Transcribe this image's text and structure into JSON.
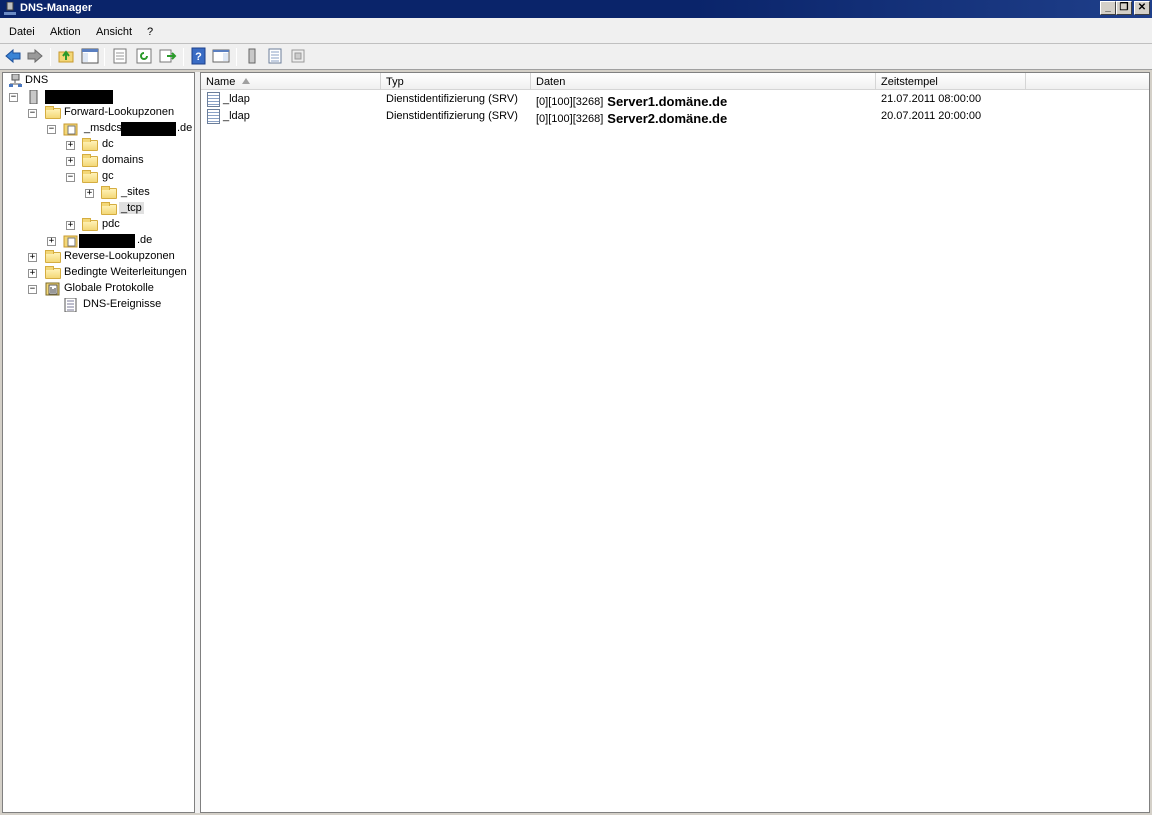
{
  "window": {
    "title": "DNS-Manager"
  },
  "menu": [
    "Datei",
    "Aktion",
    "Ansicht",
    "?"
  ],
  "tree": {
    "root": "DNS",
    "forward": "Forward-Lookupzonen",
    "msdcs_prefix": "_msdcs.",
    "msdcs_suffix": ".de",
    "dc": "dc",
    "domains": "domains",
    "gc": "gc",
    "sites": "_sites",
    "tcp": "_tcp",
    "pdc": "pdc",
    "zone2_suffix": ".de",
    "reverse": "Reverse-Lookupzonen",
    "conditional": "Bedingte Weiterleitungen",
    "global_logs": "Globale Protokolle",
    "dns_events": "DNS-Ereignisse"
  },
  "list": {
    "columns": [
      "Name",
      "Typ",
      "Daten",
      "Zeitstempel"
    ],
    "rows": [
      {
        "name": "_ldap",
        "type": "Dienstidentifizierung (SRV)",
        "data_prefix": "[0][100][3268]",
        "data_host": "Server1.domäne.de",
        "timestamp": "21.07.2011 08:00:00"
      },
      {
        "name": "_ldap",
        "type": "Dienstidentifizierung (SRV)",
        "data_prefix": "[0][100][3268]",
        "data_host": "Server2.domäne.de",
        "timestamp": "20.07.2011 20:00:00"
      }
    ]
  },
  "colors": {
    "titlebar": "#0a246a",
    "folder": "#f3d777",
    "accent_blue": "#2e6fd8"
  }
}
